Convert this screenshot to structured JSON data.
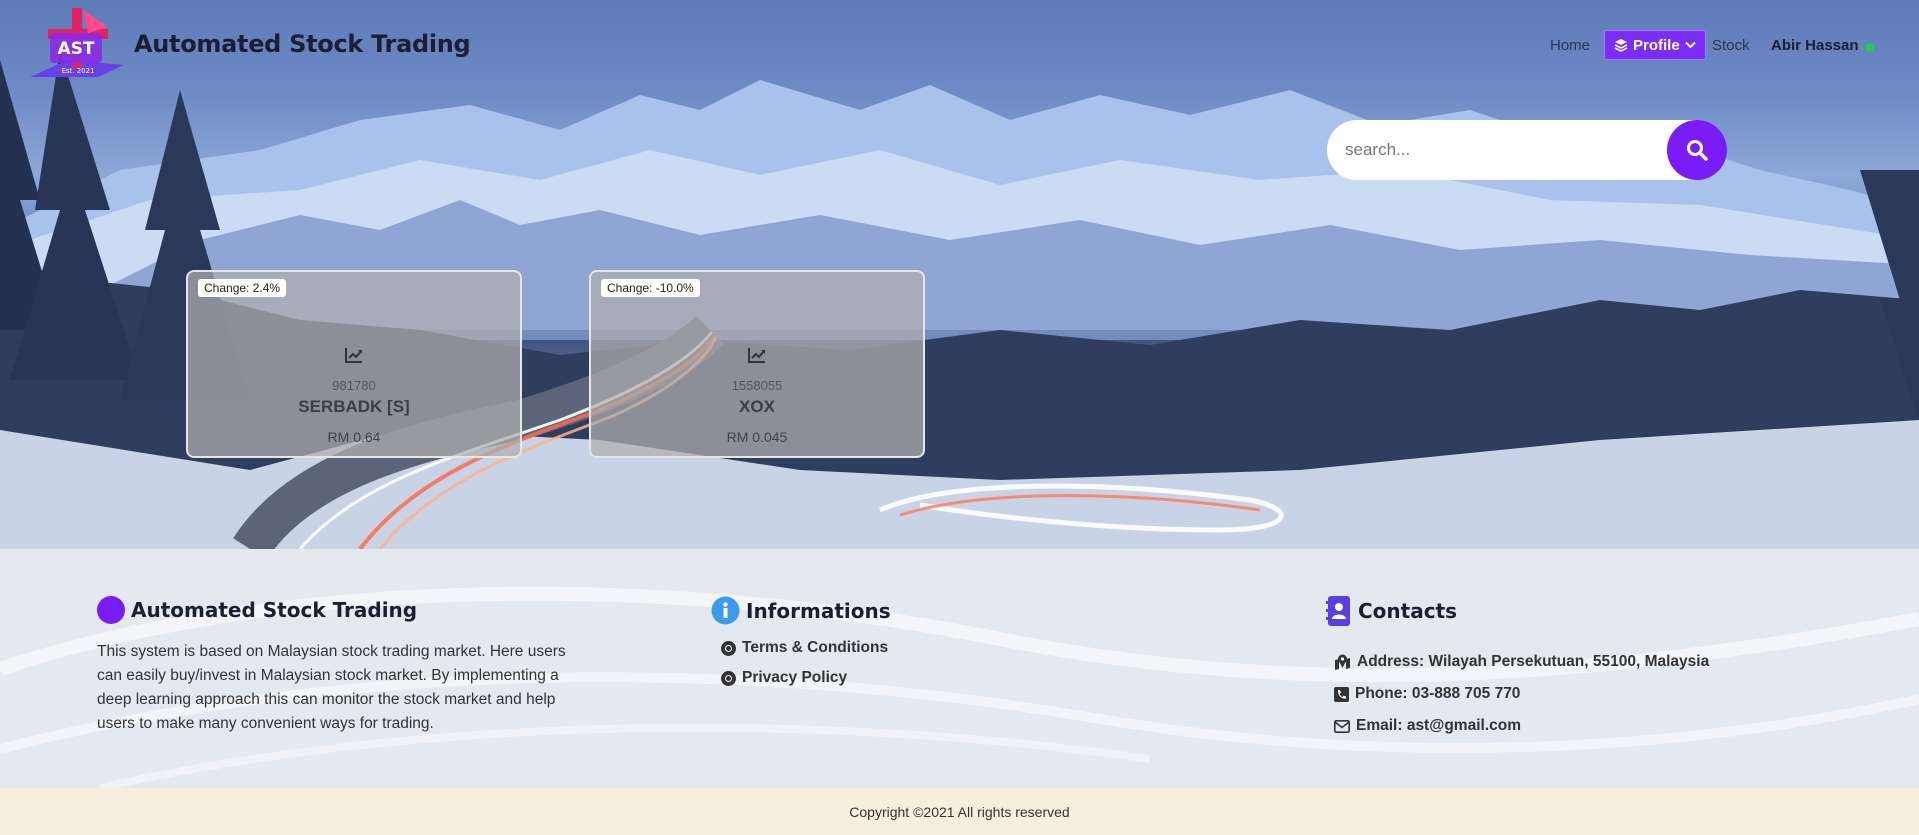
{
  "brand": {
    "logo_text": "AST",
    "logo_subtext": "Est. 2021",
    "title": "Automated Stock Trading"
  },
  "nav": {
    "home": "Home",
    "profile": "Profile",
    "stock": "Stock",
    "user": "Abir Hassan",
    "icons": {
      "profile": "layers-icon",
      "dropdown": "chevron-down-icon",
      "status": "online-dot"
    }
  },
  "search": {
    "placeholder": "search...",
    "value": ""
  },
  "stocks": [
    {
      "change": "Change: 2.4%",
      "volume": "981780",
      "symbol": "SERBADK [S]",
      "price": "RM 0.64"
    },
    {
      "change": "Change: -10.0%",
      "volume": "1558055",
      "symbol": "XOX",
      "price": "RM 0.045"
    }
  ],
  "about": {
    "title": "Automated Stock Trading",
    "text": "This system is based on Malaysian stock trading market. Here users can easily buy/invest in Malaysian stock market. By implementing a deep learning approach this can monitor the stock market and help users to make many convenient ways for trading."
  },
  "informations": {
    "title": "Informations",
    "links": [
      "Terms & Conditions",
      "Privacy Policy"
    ]
  },
  "contacts": {
    "title": "Contacts",
    "address": "Address: Wilayah Persekutuan, 55100, Malaysia",
    "phone": "Phone: 03-888 705 770",
    "email": "Email: ast@gmail.com"
  },
  "footer": {
    "copyright": "Copyright ©2021 All rights reserved"
  },
  "colors": {
    "accent": "#7a1cf6",
    "info_icon": "#3d9be9",
    "contact_icon": "#5a3fe0",
    "footer_bg": "#f7efde",
    "online": "#18d24a"
  }
}
